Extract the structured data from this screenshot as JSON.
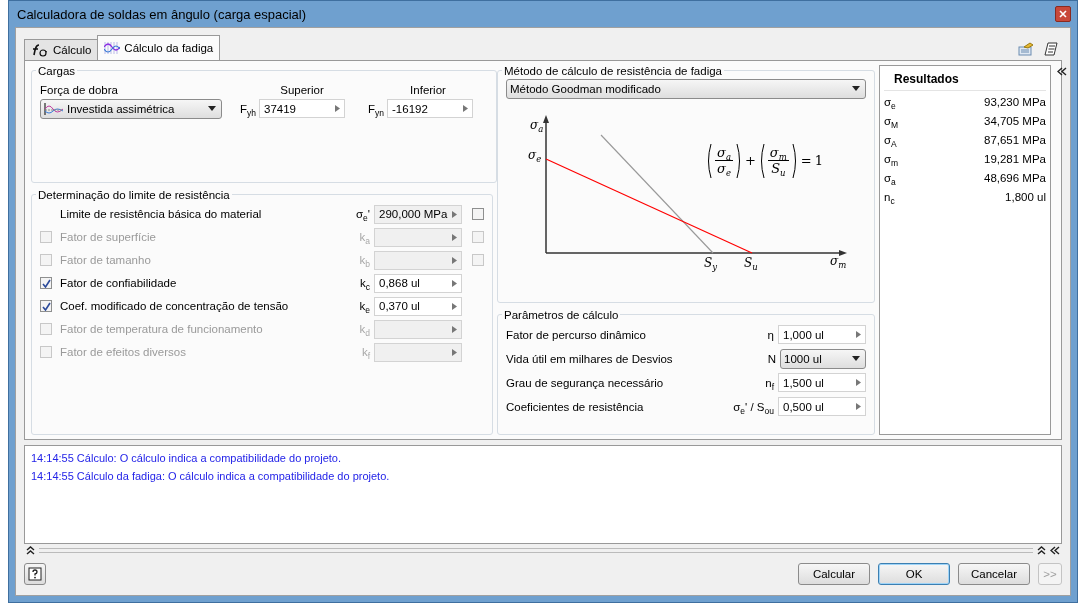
{
  "window": {
    "title": "Calculadora de soldas em ângulo (carga espacial)"
  },
  "tabs": [
    {
      "label": "Cálculo",
      "selected": false
    },
    {
      "label": "Cálculo da fadiga",
      "selected": true
    }
  ],
  "loads": {
    "title": "Cargas",
    "force_label": "Força de dobra",
    "force_type": "Investida assimétrica",
    "upper": {
      "label": "Superior",
      "symbol": "F$_{yh}$",
      "value": "37419"
    },
    "lower": {
      "label": "Inferior",
      "symbol": "F$_{yn}$",
      "value": "-16192"
    }
  },
  "endurance": {
    "title": "Determinação do limite de resistência",
    "rows": [
      {
        "kind": "plain",
        "label": "Limite de resistência básica do material",
        "symbol": "σ$_{e}$'",
        "value": "290,000 MPa",
        "enabled": true,
        "side_check": {
          "checked": false
        }
      },
      {
        "kind": "check",
        "label": "Fator de superfície",
        "symbol": "k$_{a}$",
        "checked": false,
        "enabled": false,
        "side_check": {
          "checked": false
        }
      },
      {
        "kind": "check",
        "label": "Fator de tamanho",
        "symbol": "k$_{b}$",
        "checked": false,
        "enabled": false,
        "side_check": {
          "checked": false
        }
      },
      {
        "kind": "check",
        "label": "Fator de confiabilidade",
        "symbol": "k$_{c}$",
        "value": "0,868 ul",
        "checked": true,
        "enabled": true
      },
      {
        "kind": "check",
        "label": "Coef. modificado de concentração de tensão",
        "symbol": "k$_{e}$",
        "value": "0,370 ul",
        "checked": true,
        "enabled": true
      },
      {
        "kind": "check",
        "label": "Fator de temperatura de funcionamento",
        "symbol": "k$_{d}$",
        "checked": false,
        "enabled": false
      },
      {
        "kind": "check",
        "label": "Fator de efeitos diversos",
        "symbol": "k$_{f}$",
        "checked": false,
        "enabled": false
      }
    ]
  },
  "method": {
    "title": "Método de cálculo de resistência de fadiga",
    "value": "Método Goodman modificado",
    "diagram": {
      "y_axis": "σ$_{a}$",
      "y_mark": "σ$_{e}$",
      "x_marks": [
        "S$_{y}$",
        "S$_{u}$"
      ],
      "x_axis": "σ$_{m}$",
      "formula": {
        "terms": [
          {
            "num": "σ$_{a}$",
            "den": "σ$_{e}$"
          },
          {
            "num": "σ$_{m}$",
            "den": "S$_{u}$"
          }
        ],
        "operator": "+",
        "equals": "=",
        "rhs": "1"
      }
    }
  },
  "parameters": {
    "title": "Parâmetros de cálculo",
    "rows": [
      {
        "kind": "spin",
        "label": "Fator de percurso dinâmico",
        "symbol": "η",
        "value": "1,000 ul"
      },
      {
        "kind": "dropdown",
        "label": "Vida útil em milhares de Desvios",
        "symbol": "N",
        "value": "1000 ul"
      },
      {
        "kind": "spin",
        "label": "Grau de segurança necessário",
        "symbol": "n$_{f}$",
        "value": "1,500 ul"
      },
      {
        "kind": "spin",
        "label": "Coeficientes de resistência",
        "symbol": "σ$_{e}$' / S$_{ou}$",
        "value": "0,500 ul"
      }
    ]
  },
  "results": {
    "title": "Resultados",
    "rows": [
      {
        "symbol": "σ$_{e}$",
        "value": "93,230 MPa"
      },
      {
        "symbol": "σ$_{M}$",
        "value": "34,705 MPa"
      },
      {
        "symbol": "σ$_{A}$",
        "value": "87,651 MPa"
      },
      {
        "symbol": "σ$_{m}$",
        "value": "19,281 MPa"
      },
      {
        "symbol": "σ$_{a}$",
        "value": "48,696 MPa"
      },
      {
        "symbol": "n$_{c}$",
        "value": "1,800 ul"
      }
    ]
  },
  "messages": [
    "14:14:55 Cálculo: O cálculo indica a compatibilidade do projeto.",
    "14:14:55 Cálculo da fadiga: O cálculo indica a compatibilidade do projeto."
  ],
  "buttons": [
    {
      "label": "Calcular",
      "default": false,
      "disabled": false
    },
    {
      "label": "OK",
      "default": true,
      "disabled": false
    },
    {
      "label": "Cancelar",
      "default": false,
      "disabled": false
    },
    {
      "label": ">>",
      "default": false,
      "disabled": true
    }
  ]
}
